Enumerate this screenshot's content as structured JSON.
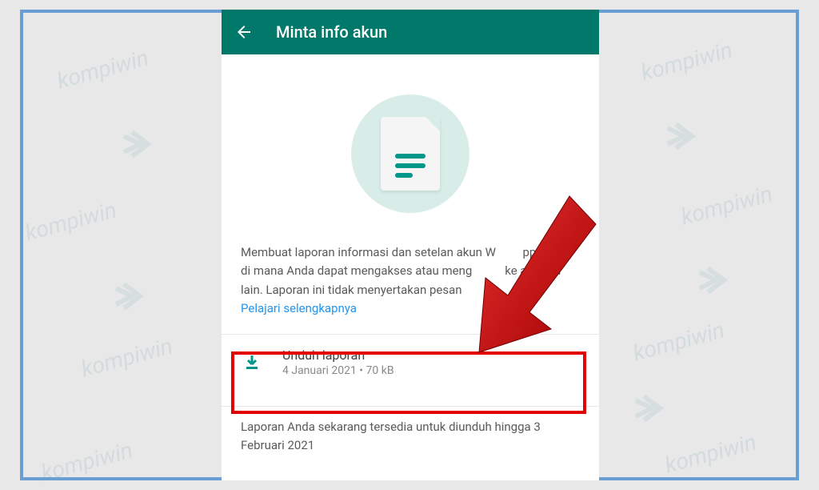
{
  "watermark": "kompiwin",
  "appBar": {
    "title": "Minta info akun"
  },
  "description": {
    "line1": "Membuat laporan informasi dan setelan akun W",
    "line1b": "pp Anda,",
    "line2": "di mana Anda dapat mengakses atau meng",
    "line2b": "ke aplikasi",
    "line3": "lain. Laporan ini tidak menyertakan pesan",
    "link": "Pelajari selengkapnya"
  },
  "download": {
    "title": "Unduh laporan",
    "meta": "4 Januari 2021 • 70 kB"
  },
  "footer": {
    "text": "Laporan Anda sekarang tersedia untuk diunduh hingga 3 Februari 2021"
  }
}
